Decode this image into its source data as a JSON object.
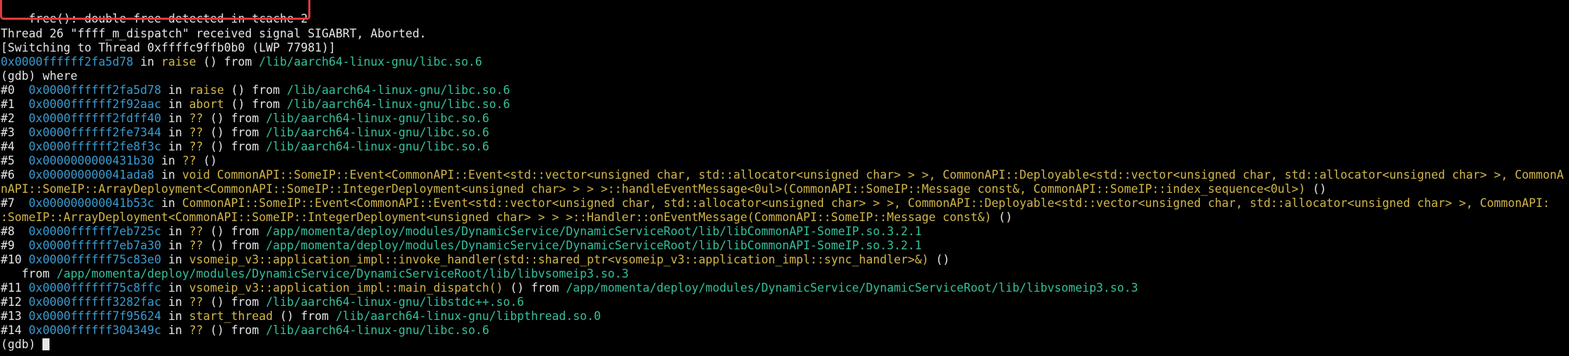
{
  "colors": {
    "background": "#000000",
    "text": "#e6e6e6",
    "address": "#3a9bd0",
    "function": "#d2b64a",
    "path": "#36c09c",
    "highlight": "#e13a3a"
  },
  "terminal": {
    "error_line": "free(): double free detected in tcache 2",
    "signal_line": "Thread 26 \"ffff_m_dispatch\" received signal SIGABRT, Aborted.",
    "switch_line": "[Switching to Thread 0xffffc9ffb0b0 (LWP 77981)]",
    "frame0": {
      "addr": "0x0000ffffff2fa5d78",
      "in": " in ",
      "func": "raise",
      "args_from": " () from ",
      "path": "/lib/aarch64-linux-gnu/libc.so.6"
    },
    "where_cmd": "(gdb) where",
    "frames": [
      {
        "prefix": "#0  ",
        "addr": "0x0000ffffff2fa5d78",
        "in": " in ",
        "func": "raise",
        "mid": " () from ",
        "path": "/lib/aarch64-linux-gnu/libc.so.6"
      },
      {
        "prefix": "#1  ",
        "addr": "0x0000ffffff2f92aac",
        "in": " in ",
        "func": "abort",
        "mid": " () from ",
        "path": "/lib/aarch64-linux-gnu/libc.so.6"
      },
      {
        "prefix": "#2  ",
        "addr": "0x0000ffffff2fdff40",
        "in": " in ",
        "func": "??",
        "mid": " () from ",
        "path": "/lib/aarch64-linux-gnu/libc.so.6"
      },
      {
        "prefix": "#3  ",
        "addr": "0x0000ffffff2fe7344",
        "in": " in ",
        "func": "??",
        "mid": " () from ",
        "path": "/lib/aarch64-linux-gnu/libc.so.6"
      },
      {
        "prefix": "#4  ",
        "addr": "0x0000ffffff2fe8f3c",
        "in": " in ",
        "func": "??",
        "mid": " () from ",
        "path": "/lib/aarch64-linux-gnu/libc.so.6"
      },
      {
        "prefix": "#5  ",
        "addr": "0x0000000000431b30",
        "in": " in ",
        "func": "??",
        "mid": " ()",
        "path": ""
      }
    ],
    "frame6": {
      "prefix": "#6  ",
      "addr": "0x000000000041ada8",
      "in": " in ",
      "func_line1": "void CommonAPI::SomeIP::Event<CommonAPI::Event<std::vector<unsigned char, std::allocator<unsigned char> > >, CommonAPI::Deployable<std::vector<unsigned char, std::allocator<unsigned char> >, CommonA",
      "func_line2": "nAPI::SomeIP::ArrayDeployment<CommonAPI::SomeIP::IntegerDeployment<unsigned char> > > >::handleEventMessage<0ul>(CommonAPI::SomeIP::Message const&, CommonAPI::SomeIP::index_sequence<0ul>)",
      "tail": " ()"
    },
    "frame7": {
      "prefix": "#7  ",
      "addr": "0x000000000041b53c",
      "in": " in ",
      "func_line1": "CommonAPI::SomeIP::Event<CommonAPI::Event<std::vector<unsigned char, std::allocator<unsigned char> > >, CommonAPI::Deployable<std::vector<unsigned char, std::allocator<unsigned char> >, CommonAPI:",
      "func_line2": ":SomeIP::ArrayDeployment<CommonAPI::SomeIP::IntegerDeployment<unsigned char> > > >::Handler::onEventMessage(CommonAPI::SomeIP::Message const&)",
      "tail": " ()"
    },
    "frame8": {
      "prefix": "#8  ",
      "addr": "0x0000ffffff7eb725c",
      "in": " in ",
      "func": "??",
      "mid": " () from ",
      "path": "/app/momenta/deploy/modules/DynamicService/DynamicServiceRoot/lib/libCommonAPI-SomeIP.so.3.2.1"
    },
    "frame9": {
      "prefix": "#9  ",
      "addr": "0x0000ffffff7eb7a30",
      "in": " in ",
      "func": "??",
      "mid": " () from ",
      "path": "/app/momenta/deploy/modules/DynamicService/DynamicServiceRoot/lib/libCommonAPI-SomeIP.so.3.2.1"
    },
    "frame10": {
      "prefix": "#10 ",
      "addr": "0x0000ffffff75c83e0",
      "in": " in ",
      "func": "vsomeip_v3::application_impl::invoke_handler(std::shared_ptr<vsomeip_v3::application_impl::sync_handler>&)",
      "tail": " ()",
      "from": "   from ",
      "path": "/app/momenta/deploy/modules/DynamicService/DynamicServiceRoot/lib/libvsomeip3.so.3"
    },
    "frame11": {
      "prefix": "#11 ",
      "addr": "0x0000ffffff75c8ffc",
      "in": " in ",
      "func": "vsomeip_v3::application_impl::main_dispatch()",
      "mid": " () from ",
      "path": "/app/momenta/deploy/modules/DynamicService/DynamicServiceRoot/lib/libvsomeip3.so.3"
    },
    "frame12": {
      "prefix": "#12 ",
      "addr": "0x0000ffffff3282fac",
      "in": " in ",
      "func": "??",
      "mid": " () from ",
      "path": "/lib/aarch64-linux-gnu/libstdc++.so.6"
    },
    "frame13": {
      "prefix": "#13 ",
      "addr": "0x0000ffffff7f95624",
      "in": " in ",
      "func": "start_thread",
      "mid": " () from ",
      "path": "/lib/aarch64-linux-gnu/libpthread.so.0"
    },
    "frame14": {
      "prefix": "#14 ",
      "addr": "0x0000ffffff304349c",
      "in": " in ",
      "func": "??",
      "mid": " () from ",
      "path": "/lib/aarch64-linux-gnu/libc.so.6"
    },
    "prompt": "(gdb) "
  }
}
